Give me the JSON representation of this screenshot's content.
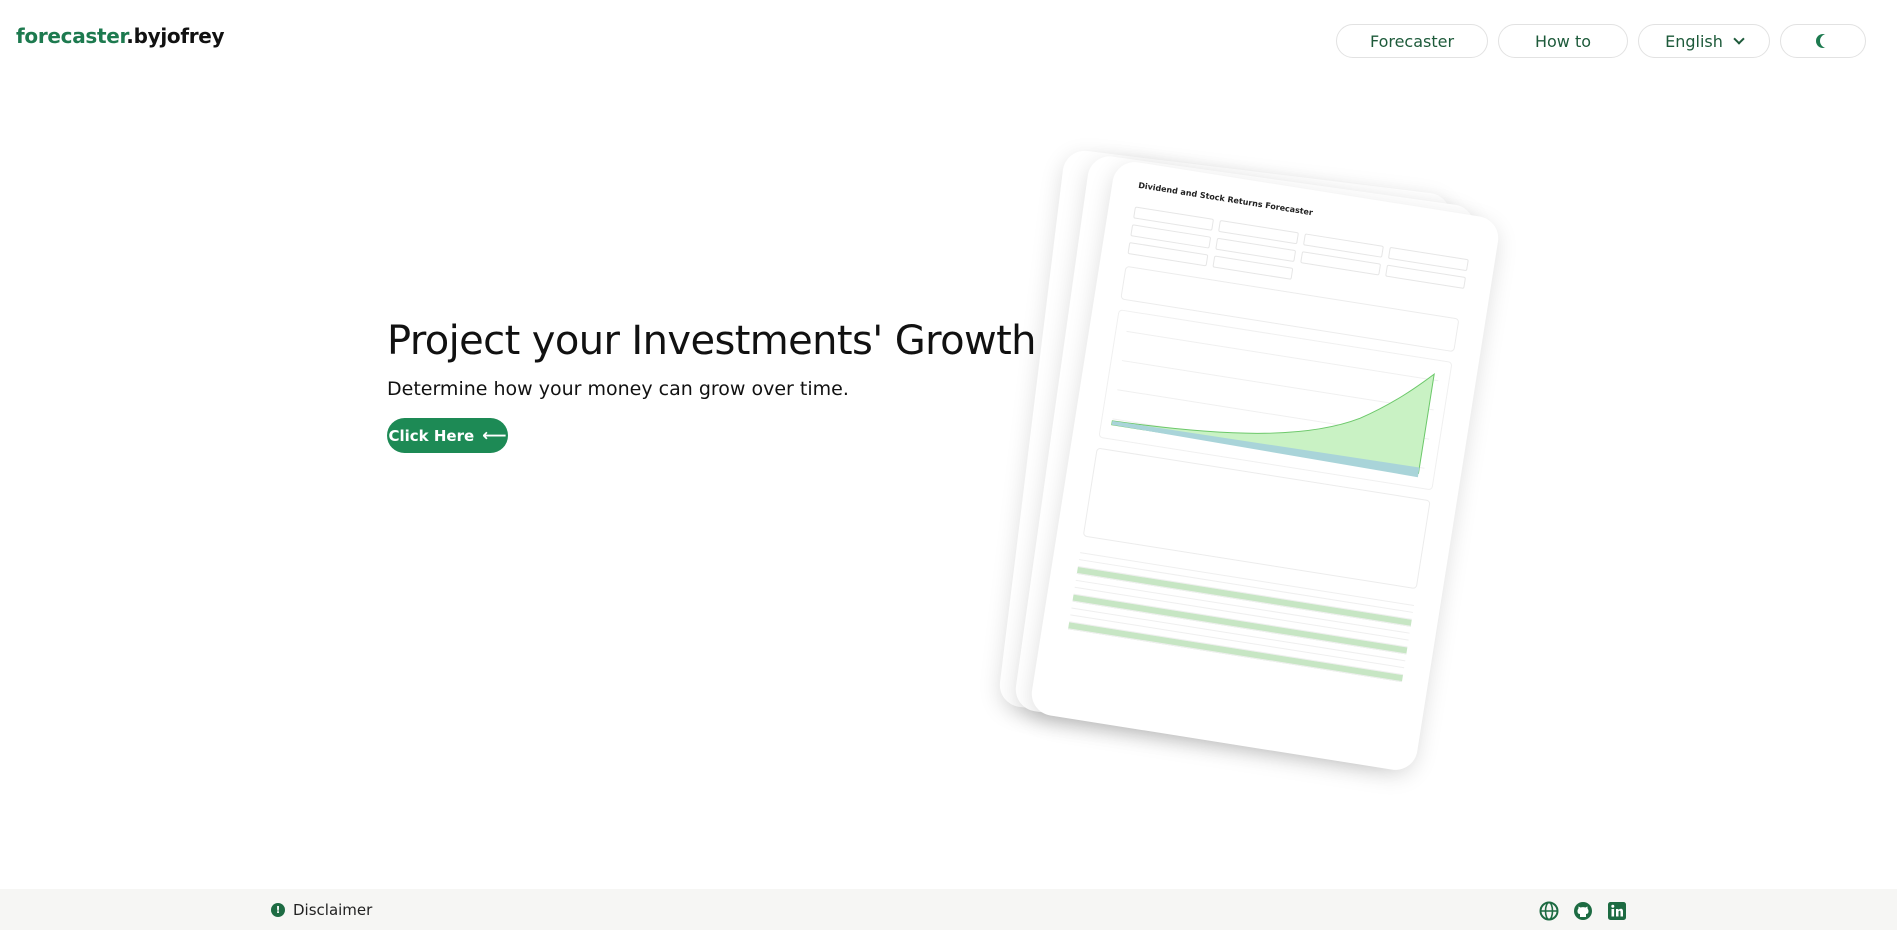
{
  "header": {
    "logo_brand": "forecaster",
    "logo_suffix": ".byjofrey",
    "nav": {
      "forecaster": "Forecaster",
      "how_to": "How to",
      "language": "English",
      "theme_icon": "moon-icon"
    }
  },
  "hero": {
    "title": "Project your Investments' Growth",
    "subtitle": "Determine how your money can grow over time.",
    "cta_label": "Click Here",
    "cta_icon": "arrow-left-icon"
  },
  "preview": {
    "title": "Dividend and Stock Returns Forecaster"
  },
  "footer": {
    "disclaimer": "Disclaimer",
    "icons": [
      "globe-icon",
      "github-icon",
      "linkedin-icon"
    ]
  },
  "colors": {
    "brand": "#1d7a4f",
    "cta": "#1d8a55",
    "chart_fill": "#c9f2c4",
    "footer_bg": "#f6f6f4"
  }
}
